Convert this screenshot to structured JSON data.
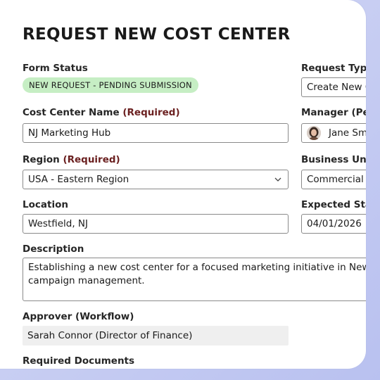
{
  "form": {
    "title": "REQUEST NEW COST CENTER",
    "form_status": {
      "label": "Form Status",
      "badge": "NEW REQUEST - PENDING SUBMISSION",
      "badge_color": "#c6eec4"
    },
    "cost_center_name": {
      "label": "Cost Center Name",
      "required": "(Required)",
      "value": "NJ Marketing Hub"
    },
    "region": {
      "label": "Region",
      "required": "(Required)",
      "value": "USA - Eastern Region",
      "icon": "chevron-down-icon"
    },
    "location": {
      "label": "Location",
      "value": "Westfield, NJ"
    },
    "description": {
      "label": "Description",
      "line1": "Establishing a new cost center for a focused marketing initiative in New Jersey, sup",
      "line2": "campaign management."
    },
    "approver": {
      "label": "Approver (Workflow)",
      "value": "Sarah Connor (Director of Finance)"
    },
    "required_documents": {
      "label": "Required Documents"
    },
    "request_type": {
      "label": "Request Type",
      "value": "Create New Co"
    },
    "manager": {
      "label": "Manager (Peop",
      "value": "Jane Smit",
      "icon": "avatar"
    },
    "business_unit": {
      "label": "Business Unit",
      "value": "Commercial Di"
    },
    "expected_start": {
      "label": "Expected Start D",
      "value": "04/01/2026"
    }
  },
  "colors": {
    "required_text": "#6b2020",
    "page_bg": "#c9cff3"
  }
}
